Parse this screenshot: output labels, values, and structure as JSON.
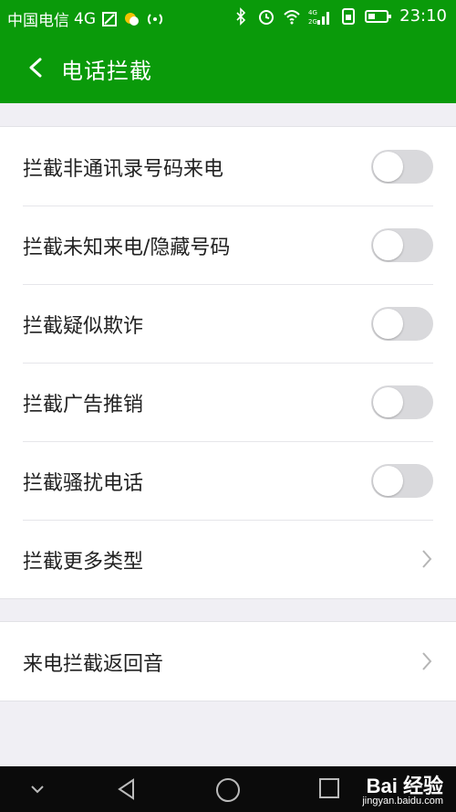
{
  "status_bar": {
    "carrier": "中国电信",
    "network": "4G",
    "time": "23:10",
    "icons": [
      "sim-card-icon",
      "weather-icon",
      "hotspot-icon",
      "bluetooth-icon",
      "alarm-icon",
      "wifi-icon",
      "signal-icon",
      "battery-icon"
    ]
  },
  "app_bar": {
    "title": "电话拦截",
    "back_icon": "back-arrow-icon"
  },
  "group1": {
    "items": [
      {
        "label": "拦截非通讯录号码来电",
        "type": "toggle",
        "checked": false
      },
      {
        "label": "拦截未知来电/隐藏号码",
        "type": "toggle",
        "checked": false
      },
      {
        "label": "拦截疑似欺诈",
        "type": "toggle",
        "checked": false
      },
      {
        "label": "拦截广告推销",
        "type": "toggle",
        "checked": false
      },
      {
        "label": "拦截骚扰电话",
        "type": "toggle",
        "checked": false
      },
      {
        "label": "拦截更多类型",
        "type": "link"
      }
    ]
  },
  "group2": {
    "items": [
      {
        "label": "来电拦截返回音",
        "type": "link"
      }
    ]
  },
  "nav_bar": {
    "buttons": [
      "collapse-icon",
      "back-triangle-icon",
      "home-circle-icon",
      "recents-square-icon"
    ],
    "watermark": "Bai 经验",
    "watermark_sub": "jingyan.baidu.com"
  },
  "colors": {
    "accent": "#0a9a0a",
    "background": "#f0eff4",
    "toggle_off": "#d9d9dc"
  }
}
